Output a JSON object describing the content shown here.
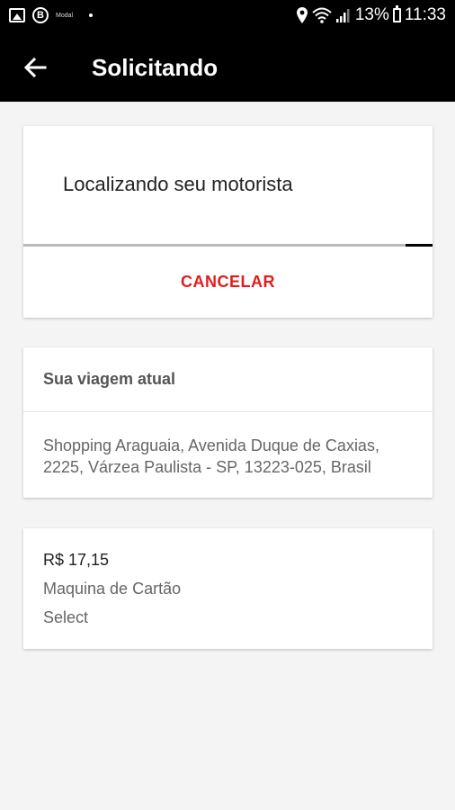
{
  "status_bar": {
    "small_label": "Modal",
    "battery": "13%",
    "time": "11:33"
  },
  "app_bar": {
    "title": "Solicitando"
  },
  "search_card": {
    "message": "Localizando seu motorista",
    "progress": 0.065,
    "cancel_label": "CANCELAR"
  },
  "trip_card": {
    "heading": "Sua viagem atual",
    "address": "Shopping Araguaia, Avenida Duque de Caxias, 2225, Várzea Paulista - SP, 13223-025, Brasil"
  },
  "payment_card": {
    "price": "R$ 17,15",
    "method": "Maquina de Cartão",
    "select_label": "Select"
  },
  "colors": {
    "app_bar_bg": "#000000",
    "accent_red": "#e31c1c",
    "page_bg": "#f5f4f5"
  },
  "icons": [
    "image-icon",
    "b-badge-icon",
    "location-pin-icon",
    "wifi-icon",
    "signal-icon",
    "battery-icon",
    "back-arrow-icon"
  ]
}
